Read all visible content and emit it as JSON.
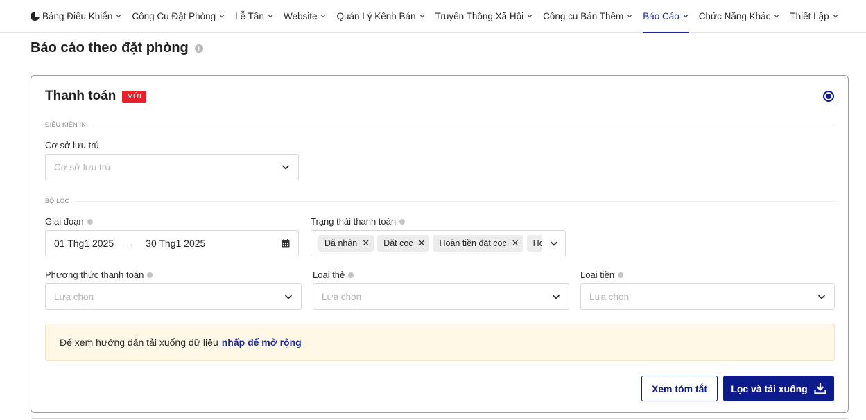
{
  "nav": {
    "items": [
      {
        "label": "Bảng Điều Khiển",
        "name": "nav-dashboard",
        "active": false
      },
      {
        "label": "Công Cụ Đặt Phòng",
        "name": "nav-booking-tools",
        "active": false
      },
      {
        "label": "Lễ Tân",
        "name": "nav-front-desk",
        "active": false
      },
      {
        "label": "Website",
        "name": "nav-website",
        "active": false
      },
      {
        "label": "Quản Lý Kênh Bán",
        "name": "nav-channel-manager",
        "active": false
      },
      {
        "label": "Truyền Thông Xã Hội",
        "name": "nav-social-media",
        "active": false
      },
      {
        "label": "Công cụ Bán Thêm",
        "name": "nav-upsell-tools",
        "active": false
      },
      {
        "label": "Báo Cáo",
        "name": "nav-reports",
        "active": true
      },
      {
        "label": "Chức Năng Khác",
        "name": "nav-other-functions",
        "active": false
      },
      {
        "label": "Thiết Lập",
        "name": "nav-settings",
        "active": false
      }
    ]
  },
  "page": {
    "title": "Báo cáo theo đặt phòng"
  },
  "card": {
    "title": "Thanh toán",
    "badge": "MỚI",
    "print_conditions_label": "ĐIỀU KIỆN IN",
    "property": {
      "label": "Cơ sở lưu trú",
      "placeholder": "Cơ sở lưu trú"
    },
    "filters_label": "BỘ LỌC",
    "period": {
      "label": "Giai đoạn",
      "start": "01 Thg1 2025",
      "end": "30 Thg1 2025"
    },
    "payment_status": {
      "label": "Trạng thái thanh toán",
      "tags": [
        "Đã nhận",
        "Đặt cọc",
        "Hoàn tiền đặt cọc",
        "Hoàn tiền"
      ]
    },
    "payment_method": {
      "label": "Phương thức thanh toán",
      "placeholder": "Lựa chọn"
    },
    "card_type": {
      "label": "Loại thẻ",
      "placeholder": "Lựa chọn"
    },
    "currency": {
      "label": "Loại tiền",
      "placeholder": "Lựa chọn"
    },
    "notice": {
      "text": "Để xem hướng dẫn tải xuống dữ liệu",
      "link": "nhấp để mở rộng"
    },
    "buttons": {
      "summary": "Xem tóm tắt",
      "download": "Lọc và tải xuống"
    }
  },
  "colors": {
    "accent": "#0d1a8c",
    "badge": "#e8202a",
    "notice_bg": "#fff8e7"
  }
}
